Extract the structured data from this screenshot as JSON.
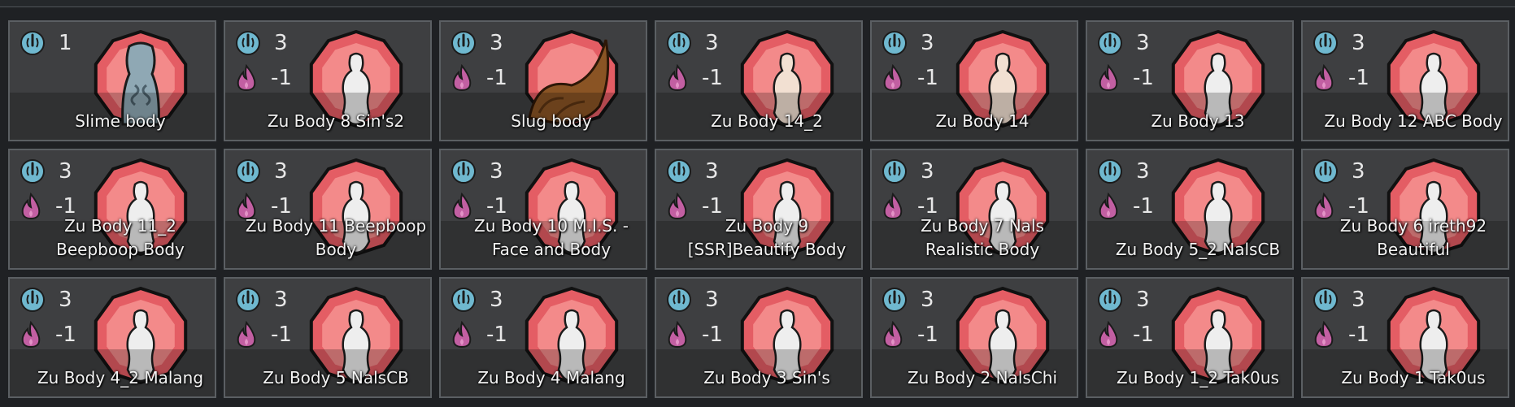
{
  "colors": {
    "cost_icon": "#6fb8cf",
    "food_icon": "#c25fa2",
    "portrait_outer": "#e45d64",
    "portrait_inner": "#f38a8a",
    "card_bg": "#3e3f41"
  },
  "icons": {
    "cost": "lightning-circle-icon",
    "food": "flame-icon"
  },
  "rows": [
    [
      {
        "name": "Slime body",
        "cost": "1",
        "food": null,
        "figure": "slime"
      },
      {
        "name": "Zu Body 8 Sin's2",
        "cost": "3",
        "food": "-1",
        "figure": "white"
      },
      {
        "name": "Slug body",
        "cost": "3",
        "food": "-1",
        "figure": "slug"
      },
      {
        "name": "Zu Body 14_2",
        "cost": "3",
        "food": "-1",
        "figure": "cream"
      },
      {
        "name": "Zu Body 14",
        "cost": "3",
        "food": "-1",
        "figure": "cream"
      },
      {
        "name": "Zu Body 13",
        "cost": "3",
        "food": "-1",
        "figure": "white"
      },
      {
        "name": "Zu Body 12 ABC Body",
        "cost": "3",
        "food": "-1",
        "figure": "white"
      }
    ],
    [
      {
        "name": "Zu Body 11_2 Beepboop Body",
        "cost": "3",
        "food": "-1",
        "figure": "white"
      },
      {
        "name": "Zu Body 11 Beepboop Body",
        "cost": "3",
        "food": "-1",
        "figure": "white"
      },
      {
        "name": "Zu Body 10 M.I.S. - Face and Body",
        "cost": "3",
        "food": "-1",
        "figure": "white"
      },
      {
        "name": "Zu Body 9 [SSR]Beautify Body",
        "cost": "3",
        "food": "-1",
        "figure": "white"
      },
      {
        "name": "Zu Body 7 Nals Realistic Body",
        "cost": "3",
        "food": "-1",
        "figure": "white"
      },
      {
        "name": "Zu Body 5_2 NalsCB",
        "cost": "3",
        "food": "-1",
        "figure": "white"
      },
      {
        "name": "Zu Body 6 ireth92 Beautiful",
        "cost": "3",
        "food": "-1",
        "figure": "white"
      }
    ],
    [
      {
        "name": "Zu Body 4_2 Malang",
        "cost": "3",
        "food": "-1",
        "figure": "white"
      },
      {
        "name": "Zu Body 5 NalsCB",
        "cost": "3",
        "food": "-1",
        "figure": "white"
      },
      {
        "name": "Zu Body 4 Malang",
        "cost": "3",
        "food": "-1",
        "figure": "white"
      },
      {
        "name": "Zu Body 3 Sin's",
        "cost": "3",
        "food": "-1",
        "figure": "white"
      },
      {
        "name": "Zu Body 2 NalsChi",
        "cost": "3",
        "food": "-1",
        "figure": "white"
      },
      {
        "name": "Zu Body 1_2 Tak0us",
        "cost": "3",
        "food": "-1",
        "figure": "white"
      },
      {
        "name": "Zu Body 1 Tak0us",
        "cost": "3",
        "food": "-1",
        "figure": "white"
      }
    ]
  ]
}
